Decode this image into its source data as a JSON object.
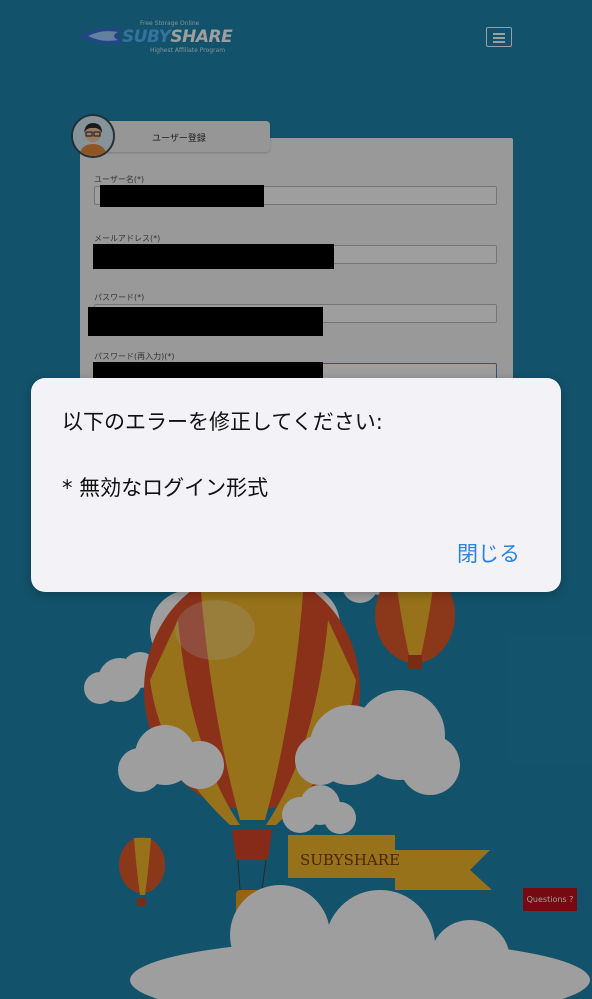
{
  "header": {
    "logo_top": "Free Storage Online",
    "logo_word_a": "SUBY",
    "logo_word_b": "SHARE",
    "logo_sub": "Highest Affiliate Program",
    "menu_icon": "hamburger-icon"
  },
  "form": {
    "tab_label": "ユーザー登録",
    "fields": [
      {
        "label": "ユーザー名(*)"
      },
      {
        "label": "メールアドレス(*)"
      },
      {
        "label": "パスワード(*)"
      },
      {
        "label": "パスワード(再入力)(*)"
      }
    ]
  },
  "scene": {
    "banner_text": "SUBYSHARE"
  },
  "questions_button": "Questions ?",
  "dialog": {
    "title": "以下のエラーを修正してください:",
    "message": "* 無効なログイン形式",
    "close_label": "閉じる"
  },
  "colors": {
    "background": "#1e86ad",
    "dialog_button": "#2a82e0",
    "questions_button": "#c0101a"
  }
}
